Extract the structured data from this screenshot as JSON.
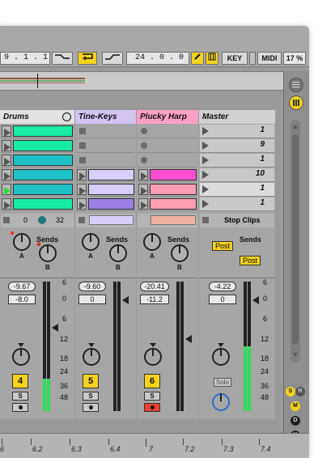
{
  "transport": {
    "position": "9 .  1 .  1",
    "time": "24 .  0 .  0",
    "key_label": "KEY",
    "midi_label": "MIDI",
    "cpu": "17 %"
  },
  "tracks": [
    {
      "name": "Drums",
      "header_color": "#e1e1e1",
      "send_a_value": "0",
      "send_b_value": "32",
      "volume_display": "-9.67",
      "peak_display": "-8.0",
      "track_number": "4",
      "solo_label": "S",
      "sends_label": "Sends",
      "knob_a": "A",
      "knob_b": "B"
    },
    {
      "name": "Tine-Keys",
      "header_color": "#d3c4f2",
      "volume_display": "-9.60",
      "peak_display": "0",
      "track_number": "5",
      "solo_label": "S",
      "sends_label": "Sends",
      "knob_a": "A",
      "knob_b": "B"
    },
    {
      "name": "Plucky Harp",
      "header_color": "#ffa1c7",
      "volume_display": "-20.41",
      "peak_display": "-11.2",
      "track_number": "6",
      "solo_label": "S",
      "sends_label": "Sends",
      "knob_a": "A",
      "knob_b": "B"
    }
  ],
  "master": {
    "name": "Master",
    "scenes": [
      "1",
      "9",
      "1",
      "10",
      "1",
      "1"
    ],
    "stop_clips_label": "Stop Clips",
    "sends_label": "Sends",
    "post_label": "Post",
    "volume_display": "-4.22",
    "peak_display": "0",
    "solo_label": "Solo"
  },
  "meter_scale": [
    "6",
    "0",
    "6",
    "12",
    "18",
    "24",
    "36",
    "48"
  ],
  "ruler": [
    "6",
    "6.2",
    "6.3",
    "6.4",
    "7",
    "7.2",
    "7.3",
    "7.4"
  ],
  "right_panel": {
    "buttons": [
      "S",
      "R",
      "M",
      "D",
      "X"
    ]
  },
  "colors": {
    "accent_yellow": "#f4d21e",
    "meter_green": "#2fdc5c",
    "drums_clip": "#19eaa6",
    "drums_clip_alt": "#1dc0c4",
    "keys_clip": "#d8cdfb",
    "keys_clip_alt": "#9b7fe6",
    "harp_clip": "#ff4dd2",
    "harp_clip_alt": "#ff9db3"
  }
}
